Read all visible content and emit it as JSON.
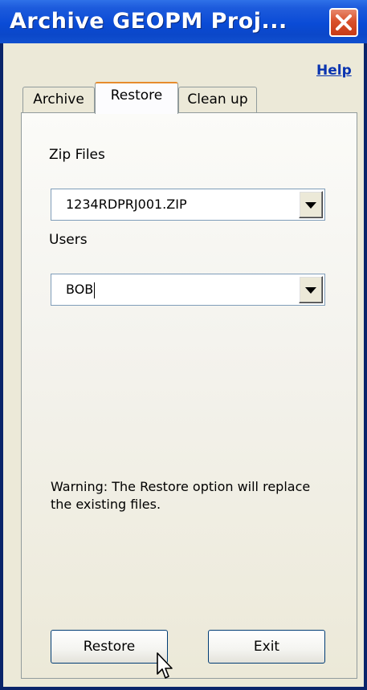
{
  "window": {
    "title": "Archive GEOPM Proj...",
    "help_label": "Help"
  },
  "tabs": [
    {
      "label": "Archive",
      "selected": false
    },
    {
      "label": "Restore",
      "selected": true
    },
    {
      "label": "Clean up",
      "selected": false
    }
  ],
  "restore": {
    "zip_files_label": "Zip Files",
    "zip_files_value": "1234RDPRJ001.ZIP",
    "users_label": "Users",
    "users_value": "BOB",
    "warning": "Warning: The Restore option will replace the existing files."
  },
  "buttons": {
    "restore_label": "Restore",
    "exit_label": "Exit"
  },
  "icons": {
    "close": "close-icon",
    "dropdown": "chevron-down-icon",
    "cursor": "mouse-pointer-icon"
  },
  "colors": {
    "title_bar": "#0a4bd6",
    "close_button": "#d9512b",
    "dialog_background": "#ece9d8",
    "link": "#0a34b0",
    "selected_tab_accent": "#e68b2c"
  }
}
